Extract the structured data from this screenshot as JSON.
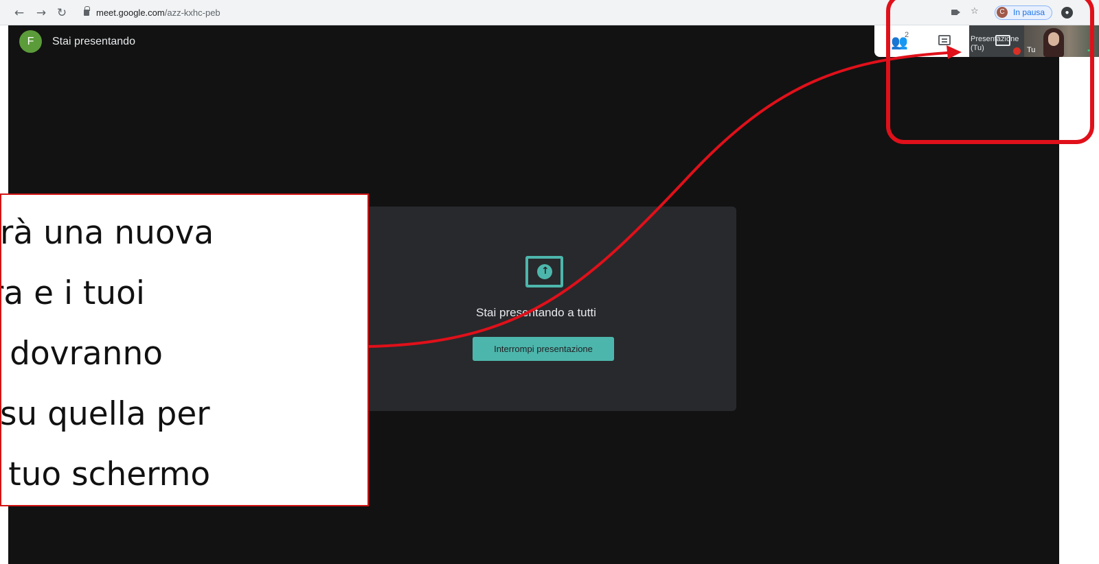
{
  "browser": {
    "url_host": "meet.google.com",
    "url_path": "/azz-kxhc-peb",
    "profile_initial": "C",
    "profile_status": "In pausa"
  },
  "meet": {
    "presenter_initial": "F",
    "presenter_label": "Stai presentando",
    "participant_count": "2",
    "presentation_tile": {
      "label_line1": "Presentazione",
      "label_line2": "(Tu)"
    },
    "self_tile_label": "Tu",
    "card": {
      "title": "Stai presentando a tutti",
      "stop_button": "Interrompi presentazione"
    },
    "accent_color": "#4db6ac"
  },
  "annotation": {
    "lines": [
      "parirà una nuova",
      "atura e i tuoi",
      "enti dovranno",
      "are su quella per",
      "re il tuo schermo"
    ],
    "highlight_color": "#e0101a"
  }
}
